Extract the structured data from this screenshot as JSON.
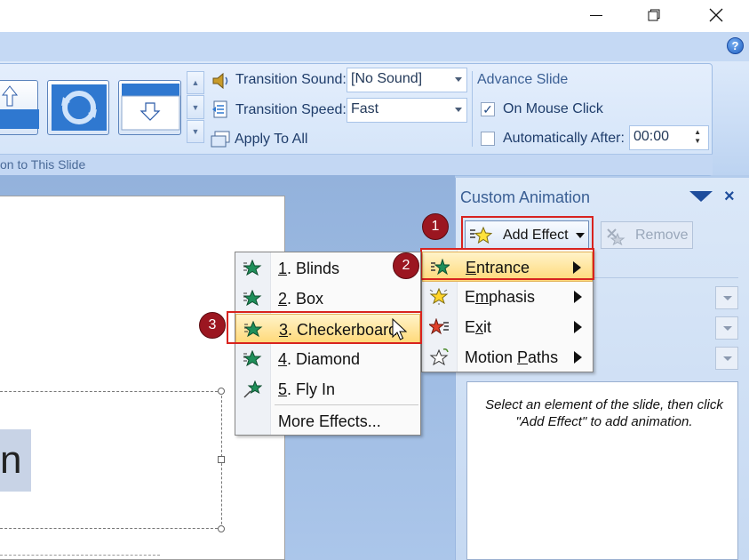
{
  "window": {
    "minimize_glyph": "—",
    "restore_glyph": "❐",
    "close_glyph": "✕"
  },
  "ribbon": {
    "help_glyph": "?",
    "transition_sound_label": "Transition Sound:",
    "transition_sound_value": "[No Sound]",
    "transition_speed_label": "Transition Speed:",
    "transition_speed_value": "Fast",
    "apply_to_all_label": "Apply To All",
    "advance_slide_title": "Advance Slide",
    "on_mouse_click_label": "On Mouse Click",
    "on_mouse_click_checked": true,
    "automatically_after_label": "Automatically After:",
    "automatically_after_checked": false,
    "automatically_after_value": "00:00",
    "group_label": "on to This Slide"
  },
  "slide": {
    "visible_text": "n"
  },
  "custom_animation": {
    "title": "Custom Animation",
    "close_glyph": "×",
    "add_effect_label": "Add Effect",
    "remove_label": "Remove",
    "hint": "Select an element of the slide, then click \"Add Effect\" to add animation."
  },
  "add_effect_menu": [
    {
      "label": "Entrance",
      "key": "E"
    },
    {
      "label": "Emphasis",
      "key": "m"
    },
    {
      "label": "Exit",
      "key": "x"
    },
    {
      "label": "Motion Paths",
      "key": "P"
    }
  ],
  "entrance_menu": [
    {
      "num": "1",
      "label": ". Blinds"
    },
    {
      "num": "2",
      "label": ". Box"
    },
    {
      "num": "3",
      "label": ". Checkerboard"
    },
    {
      "num": "4",
      "label": ". Diamond"
    },
    {
      "num": "5",
      "label": ". Fly In"
    },
    {
      "label": "More Effects..."
    }
  ],
  "callouts": [
    "1",
    "2",
    "3"
  ],
  "colors": {
    "highlight": "#ffd978",
    "callout_red": "#d8231f",
    "badge": "#9b1620",
    "ribbon": "#c9dcf5"
  }
}
